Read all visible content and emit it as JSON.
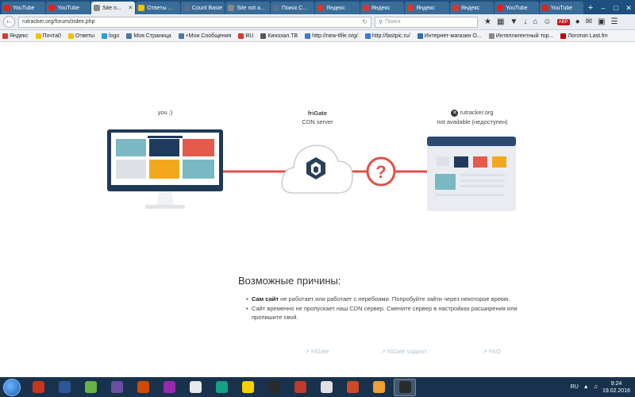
{
  "browser": {
    "tabs": [
      {
        "label": "YouTube",
        "color": "#e62117"
      },
      {
        "label": "YouTube",
        "color": "#e62117"
      },
      {
        "label": "Site n...",
        "color": "#888888",
        "active": true
      },
      {
        "label": "Ответы ...",
        "color": "#f2c200"
      },
      {
        "label": "Count Basie -...",
        "color": "#5a6e8a"
      },
      {
        "label": "Site not a...",
        "color": "#888888"
      },
      {
        "label": "Поиск С...",
        "color": "#5a6e8a"
      },
      {
        "label": "Яндекс",
        "color": "#d9382b"
      },
      {
        "label": "Яндекс",
        "color": "#d9382b"
      },
      {
        "label": "Яндекс",
        "color": "#d9382b"
      },
      {
        "label": "Яндекс",
        "color": "#d9382b"
      },
      {
        "label": "YouTube",
        "color": "#e62117"
      },
      {
        "label": "YouTube",
        "color": "#e62117"
      }
    ],
    "url": "rutracker.org/forum/index.php",
    "search_placeholder": "Поиск",
    "bookmarks": [
      {
        "label": "Яндекс",
        "color": "#d9382b"
      },
      {
        "label": "Почта0",
        "color": "#f2c200"
      },
      {
        "label": "Ответы",
        "color": "#f2c200"
      },
      {
        "label": "logo",
        "color": "#2a9dd8"
      },
      {
        "label": "Моя Страница",
        "color": "#4a76a8"
      },
      {
        "label": "+Мои Сообщения",
        "color": "#4a76a8"
      },
      {
        "label": "RU",
        "color": "#d9382b"
      },
      {
        "label": "Кинозал.ТВ",
        "color": "#555555"
      },
      {
        "label": "http://new-tfile.org/",
        "color": "#3a7bd5"
      },
      {
        "label": "http://fastpic.ru/",
        "color": "#3a7bd5"
      },
      {
        "label": "Интернет-магазин О...",
        "color": "#2f6db5"
      },
      {
        "label": "Интеллигентный тор...",
        "color": "#888888"
      },
      {
        "label": "Логотип Last.fm",
        "color": "#c3000d"
      }
    ]
  },
  "diagram": {
    "you_label": "you ;)",
    "frigate_title": "friGate",
    "frigate_sub": "CDN server",
    "site_name": "rutracker.org",
    "site_status": "not available (недоступен)"
  },
  "page": {
    "heading": "Возможные причины:",
    "reason1_bold": "Сам сайт",
    "reason1_rest": " не работает или работает с перебоями. Попробуйте зайти через некоторое время.",
    "reason2": "Сайт временно не пропускает наш CDN сервер. Смените сервер в настройках расширения или пропишите свой.",
    "links": [
      "friGate",
      "friGate support",
      "FAQ"
    ]
  },
  "taskbar": {
    "lang": "RU",
    "time": "9:24",
    "date": "19.02.2016",
    "apps": [
      "#c8361d",
      "#2b579a",
      "#67b346",
      "#6b4fa0",
      "#d04a02",
      "#9c27b0",
      "#e8e8e8",
      "#16a085",
      "#f5d100",
      "#2a2a2a",
      "#c0392b",
      "#e0e0e0",
      "#d24726",
      "#f0a030",
      "#2b2b2b"
    ]
  },
  "colors": {
    "line_red": "#e0504a",
    "question_red": "#e0504a",
    "monitor_dark": "#1f3a56",
    "tile_teal": "#7ab8c4",
    "tile_navy": "#1f3a5c",
    "tile_red": "#e55a4a",
    "tile_grey": "#dde1e5",
    "tile_yellow": "#f2a81d",
    "site_header": "#2b4a6f",
    "site_body": "#e9edf1"
  }
}
